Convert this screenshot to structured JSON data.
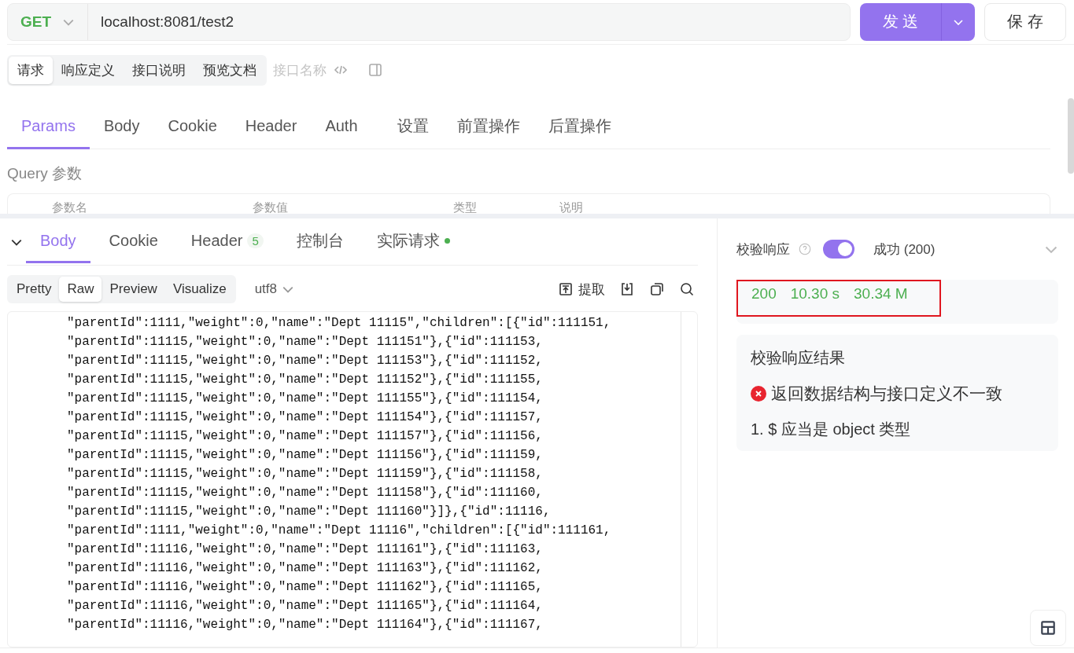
{
  "request": {
    "method": "GET",
    "url": "localhost:8081/test2",
    "send": "发 送",
    "save": "保 存"
  },
  "doc_tabs": [
    {
      "label": "请求",
      "selected": true
    },
    {
      "label": "响应定义",
      "selected": false
    },
    {
      "label": "接口说明",
      "selected": false
    },
    {
      "label": "预览文档",
      "selected": false
    }
  ],
  "name_placeholder": "接口名称",
  "tabs": [
    {
      "label": "Params",
      "selected": true
    },
    {
      "label": "Body",
      "selected": false
    },
    {
      "label": "Cookie",
      "selected": false
    },
    {
      "label": "Header",
      "selected": false
    },
    {
      "label": "Auth",
      "selected": false
    },
    {
      "label": "设置",
      "selected": false
    },
    {
      "label": "前置操作",
      "selected": false
    },
    {
      "label": "后置操作",
      "selected": false
    }
  ],
  "query": {
    "title": "Query 参数",
    "columns": [
      "参数名",
      "参数值",
      "类型",
      "说明"
    ]
  },
  "response": {
    "tabs": [
      {
        "label": "Body",
        "selected": true
      },
      {
        "label": "Cookie",
        "selected": false
      },
      {
        "label": "Header",
        "selected": false,
        "badge": "5"
      },
      {
        "label": "控制台",
        "selected": false
      },
      {
        "label": "实际请求",
        "selected": false,
        "dot": true
      }
    ],
    "modes": [
      {
        "label": "Pretty",
        "selected": false
      },
      {
        "label": "Raw",
        "selected": true
      },
      {
        "label": "Preview",
        "selected": false
      },
      {
        "label": "Visualize",
        "selected": false
      }
    ],
    "encoding": "utf8",
    "extract": "提取",
    "lines": [
      "\"parentId\":1111,\"weight\":0,\"name\":\"Dept 11115\",\"children\":[{\"id\":111151,",
      "\"parentId\":11115,\"weight\":0,\"name\":\"Dept 111151\"},{\"id\":111153,",
      "\"parentId\":11115,\"weight\":0,\"name\":\"Dept 111153\"},{\"id\":111152,",
      "\"parentId\":11115,\"weight\":0,\"name\":\"Dept 111152\"},{\"id\":111155,",
      "\"parentId\":11115,\"weight\":0,\"name\":\"Dept 111155\"},{\"id\":111154,",
      "\"parentId\":11115,\"weight\":0,\"name\":\"Dept 111154\"},{\"id\":111157,",
      "\"parentId\":11115,\"weight\":0,\"name\":\"Dept 111157\"},{\"id\":111156,",
      "\"parentId\":11115,\"weight\":0,\"name\":\"Dept 111156\"},{\"id\":111159,",
      "\"parentId\":11115,\"weight\":0,\"name\":\"Dept 111159\"},{\"id\":111158,",
      "\"parentId\":11115,\"weight\":0,\"name\":\"Dept 111158\"},{\"id\":111160,",
      "\"parentId\":11115,\"weight\":0,\"name\":\"Dept 111160\"}]},{\"id\":11116,",
      "\"parentId\":1111,\"weight\":0,\"name\":\"Dept 11116\",\"children\":[{\"id\":111161,",
      "\"parentId\":11116,\"weight\":0,\"name\":\"Dept 111161\"},{\"id\":111163,",
      "\"parentId\":11116,\"weight\":0,\"name\":\"Dept 111163\"},{\"id\":111162,",
      "\"parentId\":11116,\"weight\":0,\"name\":\"Dept 111162\"},{\"id\":111165,",
      "\"parentId\":11116,\"weight\":0,\"name\":\"Dept 111165\"},{\"id\":111164,",
      "\"parentId\":11116,\"weight\":0,\"name\":\"Dept 111164\"},{\"id\":111167,"
    ]
  },
  "validation": {
    "label": "校验响应",
    "on": true,
    "status": "成功 (200)",
    "stats": {
      "code": "200",
      "time": "10.30 s",
      "size": "30.34 M",
      "highlighted": true
    },
    "result_title": "校验响应结果",
    "error": "返回数据结构与接口定义不一致",
    "detail": "1. $ 应当是 object 类型"
  }
}
